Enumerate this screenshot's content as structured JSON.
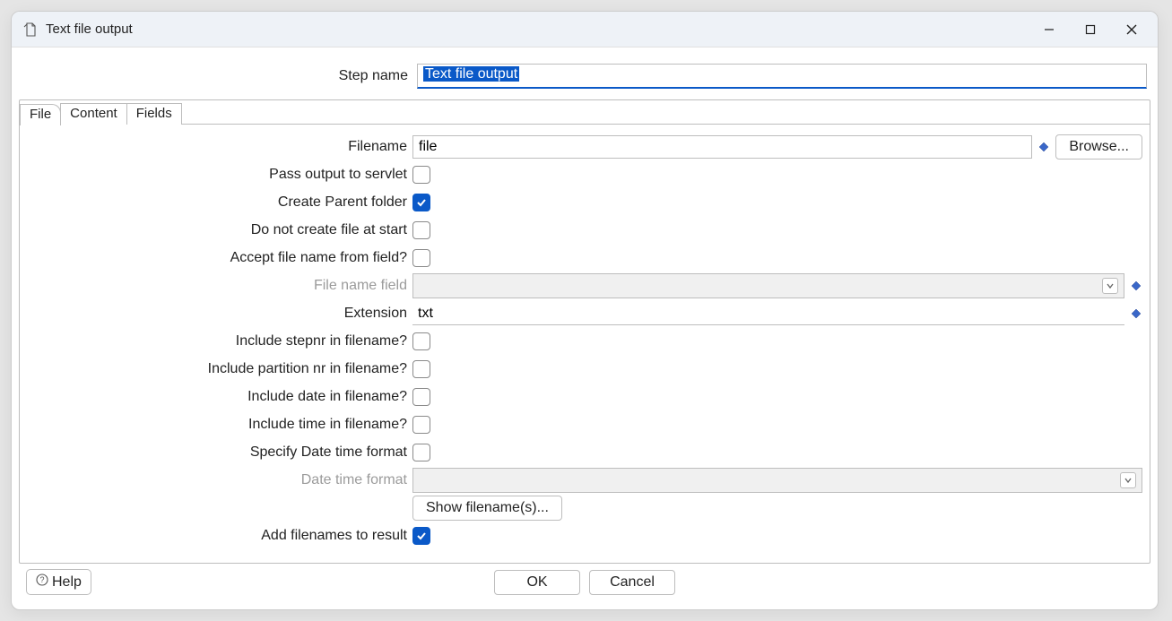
{
  "window": {
    "title": "Text file output"
  },
  "step": {
    "label": "Step name",
    "value": "Text file output"
  },
  "tabs": {
    "file": "File",
    "content": "Content",
    "fields": "Fields"
  },
  "labels": {
    "filename": "Filename",
    "passOutput": "Pass output to servlet",
    "createParent": "Create Parent folder",
    "doNotCreate": "Do not create file at start",
    "acceptFileName": "Accept file name from field?",
    "fileNameField": "File name field",
    "extension": "Extension",
    "includeStepnr": "Include stepnr in filename?",
    "includePartition": "Include partition nr in filename?",
    "includeDate": "Include date in filename?",
    "includeTime": "Include time in filename?",
    "specifyDateTime": "Specify Date time format",
    "dateTimeFormat": "Date time format",
    "addFilenames": "Add filenames to result"
  },
  "values": {
    "filename": "file",
    "extension": "txt",
    "fileNameField": "",
    "dateTimeFormat": ""
  },
  "checks": {
    "passOutput": false,
    "createParent": true,
    "doNotCreate": false,
    "acceptFileName": false,
    "includeStepnr": false,
    "includePartition": false,
    "includeDate": false,
    "includeTime": false,
    "specifyDateTime": false,
    "addFilenames": true
  },
  "buttons": {
    "browse": "Browse...",
    "showFilenames": "Show filename(s)...",
    "ok": "OK",
    "cancel": "Cancel",
    "help": "Help"
  }
}
